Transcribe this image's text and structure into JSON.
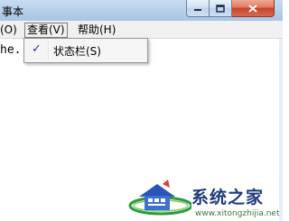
{
  "window": {
    "title": "事本",
    "minimize_icon": "minimize-icon",
    "maximize_icon": "maximize-icon",
    "close_icon": "close-icon"
  },
  "menubar": {
    "format_partial": "(O)",
    "view": "查看(V)",
    "help": "帮助(H)"
  },
  "editor": {
    "text": "he."
  },
  "dropdown": {
    "items": [
      {
        "label": "状态栏(S)",
        "checked": true,
        "check_glyph": "✓"
      }
    ]
  },
  "watermark": {
    "text": "系统之家",
    "url": "www.xitongzhijia.net"
  },
  "colors": {
    "titlebar": "#b9d1ea",
    "close_button": "#c8432a",
    "menu_bg": "#f0f0f0",
    "check": "#2b3a8a"
  }
}
